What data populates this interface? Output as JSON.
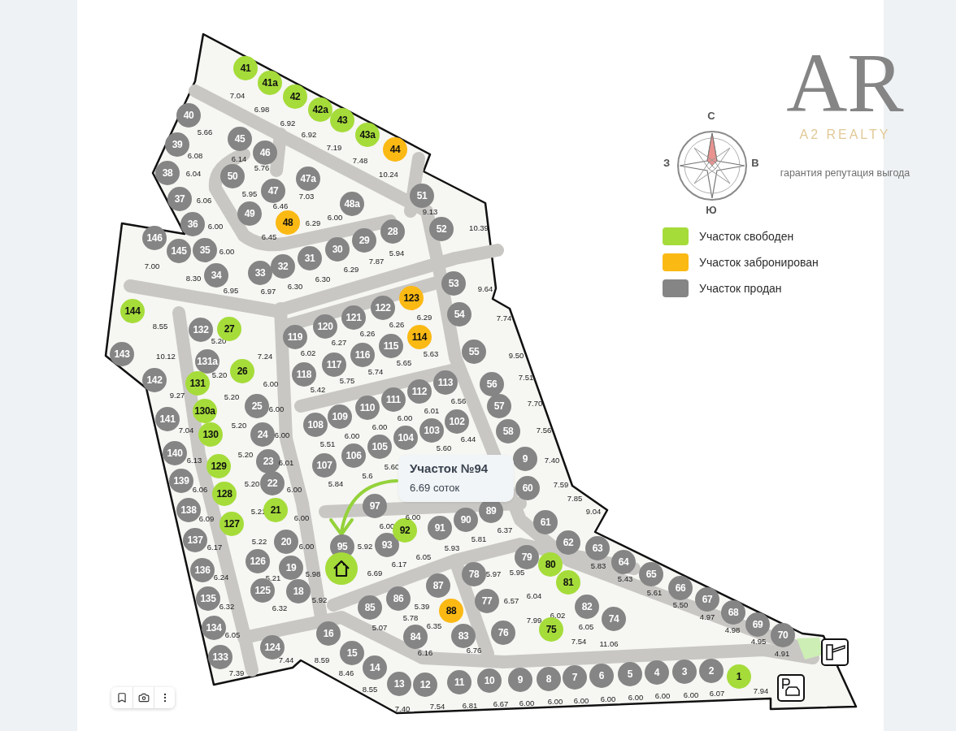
{
  "brand": {
    "mark": "AR",
    "name": "A2 REALTY",
    "tagline": "гарантия репутация выгода"
  },
  "compass": {
    "north": "С",
    "west": "З",
    "east": "В",
    "south": "Ю"
  },
  "legend": [
    {
      "label": "Участок свободен",
      "color": "#a5dc3a"
    },
    {
      "label": "Участок забронирован",
      "color": "#fbb914"
    },
    {
      "label": "Участок продан",
      "color": "#858585"
    }
  ],
  "tooltip": {
    "title": "Участок №94",
    "subtitle": "6.69 соток"
  },
  "selected_plot": {
    "area": "6.69",
    "color": "#a5dc3a"
  },
  "covered_plot": {
    "area": "6.00"
  },
  "plots": [
    {
      "number": "41",
      "area": "7.04",
      "color": "#a5dc3a"
    },
    {
      "number": "41a",
      "area": "6.98",
      "color": "#a5dc3a"
    },
    {
      "number": "42",
      "area": "6.92",
      "color": "#a5dc3a"
    },
    {
      "number": "42a",
      "area": "6.92",
      "color": "#a5dc3a"
    },
    {
      "number": "43",
      "area": "7.19",
      "color": "#a5dc3a"
    },
    {
      "number": "43a",
      "area": "7.48",
      "color": "#a5dc3a"
    },
    {
      "number": "44",
      "area": "10.24",
      "color": "#fbb914"
    },
    {
      "number": "40",
      "area": "5.66",
      "color": "#858585"
    },
    {
      "number": "39",
      "area": "6.08",
      "color": "#858585"
    },
    {
      "number": "38",
      "area": "6.04",
      "color": "#858585"
    },
    {
      "number": "37",
      "area": "6.06",
      "color": "#858585"
    },
    {
      "number": "36",
      "area": "6.00",
      "color": "#858585"
    },
    {
      "number": "35",
      "area": "6.00",
      "color": "#858585"
    },
    {
      "number": "34",
      "area": "6.95",
      "color": "#858585"
    },
    {
      "number": "45",
      "area": "6.14",
      "color": "#858585"
    },
    {
      "number": "46",
      "area": "5.76",
      "color": "#858585"
    },
    {
      "number": "50",
      "area": "5.95",
      "color": "#858585"
    },
    {
      "number": "47",
      "area": "6.46",
      "color": "#858585"
    },
    {
      "number": "47a",
      "area": "7.03",
      "color": "#858585"
    },
    {
      "number": "48a",
      "area": "6.00",
      "color": "#858585"
    },
    {
      "number": "49",
      "area": "6.45",
      "color": "#858585"
    },
    {
      "number": "48",
      "area": "6.29",
      "color": "#fbb914"
    },
    {
      "number": "51",
      "area": "9.13",
      "color": "#858585"
    },
    {
      "number": "52",
      "area": "10.39",
      "color": "#858585"
    },
    {
      "number": "146",
      "area": "7.00",
      "color": "#858585"
    },
    {
      "number": "145",
      "area": "8.30",
      "color": "#858585"
    },
    {
      "number": "33",
      "area": "6.97",
      "color": "#858585"
    },
    {
      "number": "32",
      "area": "6.30",
      "color": "#858585"
    },
    {
      "number": "31",
      "area": "6.30",
      "color": "#858585"
    },
    {
      "number": "30",
      "area": "6.29",
      "color": "#858585"
    },
    {
      "number": "29",
      "area": "7.87",
      "color": "#858585"
    },
    {
      "number": "28",
      "area": "5.94",
      "color": "#858585"
    },
    {
      "number": "53",
      "area": "9.64",
      "color": "#858585"
    },
    {
      "number": "54",
      "area": "7.74",
      "color": "#858585"
    },
    {
      "number": "55",
      "area": "9.50",
      "color": "#858585"
    },
    {
      "number": "56",
      "area": "7.51",
      "color": "#858585"
    },
    {
      "number": "57",
      "area": "7.70",
      "color": "#858585"
    },
    {
      "number": "58",
      "area": "7.56",
      "color": "#858585"
    },
    {
      "number": "9",
      "area": "7.40",
      "color": "#858585"
    },
    {
      "number": "60",
      "area": "7.59",
      "color": "#858585"
    },
    {
      "number": "61",
      "area": "7.85",
      "color": "#858585"
    },
    {
      "number": "62",
      "area": "9.04",
      "color": "#858585"
    },
    {
      "number": "63",
      "area": "5.83",
      "color": "#858585"
    },
    {
      "number": "64",
      "area": "5.43",
      "color": "#858585"
    },
    {
      "number": "65",
      "area": "5.61",
      "color": "#858585"
    },
    {
      "number": "66",
      "area": "5.50",
      "color": "#858585"
    },
    {
      "number": "67",
      "area": "4.97",
      "color": "#858585"
    },
    {
      "number": "68",
      "area": "4.98",
      "color": "#858585"
    },
    {
      "number": "69",
      "area": "4.95",
      "color": "#858585"
    },
    {
      "number": "70",
      "area": "4.91",
      "color": "#858585"
    },
    {
      "number": "144",
      "area": "8.55",
      "color": "#a5dc3a"
    },
    {
      "number": "143",
      "area": "10.12",
      "color": "#858585"
    },
    {
      "number": "142",
      "area": "9.27",
      "color": "#858585"
    },
    {
      "number": "141",
      "area": "7.04",
      "color": "#858585"
    },
    {
      "number": "140",
      "area": "6.13",
      "color": "#858585"
    },
    {
      "number": "139",
      "area": "6.06",
      "color": "#858585"
    },
    {
      "number": "138",
      "area": "6.09",
      "color": "#858585"
    },
    {
      "number": "137",
      "area": "6.17",
      "color": "#858585"
    },
    {
      "number": "136",
      "area": "6.24",
      "color": "#858585"
    },
    {
      "number": "135",
      "area": "6.32",
      "color": "#858585"
    },
    {
      "number": "134",
      "area": "6.05",
      "color": "#858585"
    },
    {
      "number": "133",
      "area": "7.39",
      "color": "#858585"
    },
    {
      "number": "132",
      "area": "5.20",
      "color": "#858585"
    },
    {
      "number": "27",
      "area": "7.24",
      "color": "#a5dc3a"
    },
    {
      "number": "131a",
      "area": "5.20",
      "color": "#858585"
    },
    {
      "number": "26",
      "area": "6.00",
      "color": "#a5dc3a"
    },
    {
      "number": "131",
      "area": "5.20",
      "color": "#a5dc3a"
    },
    {
      "number": "130a",
      "area": "5.20",
      "color": "#a5dc3a"
    },
    {
      "number": "130",
      "area": "5.20",
      "color": "#a5dc3a"
    },
    {
      "number": "129",
      "area": "5.20",
      "color": "#a5dc3a"
    },
    {
      "number": "128",
      "area": "5.21",
      "color": "#a5dc3a"
    },
    {
      "number": "127",
      "area": "5.22",
      "color": "#a5dc3a"
    },
    {
      "number": "25",
      "area": "6.00",
      "color": "#858585"
    },
    {
      "number": "24",
      "area": "6.00",
      "color": "#858585"
    },
    {
      "number": "23",
      "area": "6.01",
      "color": "#858585"
    },
    {
      "number": "22",
      "area": "6.00",
      "color": "#858585"
    },
    {
      "number": "21",
      "area": "6.00",
      "color": "#a5dc3a"
    },
    {
      "number": "20",
      "area": "6.00",
      "color": "#858585"
    },
    {
      "number": "126",
      "area": "5.21",
      "color": "#858585"
    },
    {
      "number": "19",
      "area": "5.98",
      "color": "#858585"
    },
    {
      "number": "125",
      "area": "6.32",
      "color": "#858585"
    },
    {
      "number": "18",
      "area": "5.92",
      "color": "#858585"
    },
    {
      "number": "124",
      "area": "7.44",
      "color": "#858585"
    },
    {
      "number": "16",
      "area": "8.59",
      "color": "#858585"
    },
    {
      "number": "15",
      "area": "8.46",
      "color": "#858585"
    },
    {
      "number": "14",
      "area": "8.55",
      "color": "#858585"
    },
    {
      "number": "13",
      "area": "7.40",
      "color": "#858585"
    },
    {
      "number": "12",
      "area": "7.54",
      "color": "#858585"
    },
    {
      "number": "11",
      "area": "6.81",
      "color": "#858585"
    },
    {
      "number": "10",
      "area": "6.67",
      "color": "#858585"
    },
    {
      "number": "9",
      "area": "6.00",
      "color": "#858585"
    },
    {
      "number": "8",
      "area": "6.00",
      "color": "#858585"
    },
    {
      "number": "7",
      "area": "6.00",
      "color": "#858585"
    },
    {
      "number": "6",
      "area": "6.00",
      "color": "#858585"
    },
    {
      "number": "5",
      "area": "6.00",
      "color": "#858585"
    },
    {
      "number": "4",
      "area": "6.00",
      "color": "#858585"
    },
    {
      "number": "3",
      "area": "6.00",
      "color": "#858585"
    },
    {
      "number": "2",
      "area": "6.07",
      "color": "#858585"
    },
    {
      "number": "1",
      "area": "7.94",
      "color": "#a5dc3a"
    },
    {
      "number": "119",
      "area": "6.02",
      "color": "#858585"
    },
    {
      "number": "120",
      "area": "6.27",
      "color": "#858585"
    },
    {
      "number": "121",
      "area": "6.26",
      "color": "#858585"
    },
    {
      "number": "122",
      "area": "6.26",
      "color": "#858585"
    },
    {
      "number": "123",
      "area": "6.29",
      "color": "#fbb914"
    },
    {
      "number": "118",
      "area": "5.42",
      "color": "#858585"
    },
    {
      "number": "117",
      "area": "5.75",
      "color": "#858585"
    },
    {
      "number": "116",
      "area": "5.74",
      "color": "#858585"
    },
    {
      "number": "115",
      "area": "5.65",
      "color": "#858585"
    },
    {
      "number": "114",
      "area": "5.63",
      "color": "#fbb914"
    },
    {
      "number": "108",
      "area": "5.51",
      "color": "#858585"
    },
    {
      "number": "109",
      "area": "6.00",
      "color": "#858585"
    },
    {
      "number": "110",
      "area": "6.00",
      "color": "#858585"
    },
    {
      "number": "111",
      "area": "6.00",
      "color": "#858585"
    },
    {
      "number": "112",
      "area": "6.01",
      "color": "#858585"
    },
    {
      "number": "113",
      "area": "6.56",
      "color": "#858585"
    },
    {
      "number": "107",
      "area": "5.84",
      "color": "#858585"
    },
    {
      "number": "106",
      "area": "5.6",
      "color": "#858585"
    },
    {
      "number": "105",
      "area": "5.60",
      "color": "#858585"
    },
    {
      "number": "104",
      "color": "#858585"
    },
    {
      "number": "103",
      "area": "5.60",
      "color": "#858585"
    },
    {
      "number": "102",
      "area": "6.44",
      "color": "#858585"
    },
    {
      "number": "97",
      "area": "6.00",
      "color": "#858585"
    },
    {
      "number": "95",
      "area": "5.92",
      "color": "#858585"
    },
    {
      "number": "93",
      "area": "6.17",
      "color": "#858585"
    },
    {
      "number": "92",
      "area": "6.05",
      "color": "#a5dc3a"
    },
    {
      "number": "91",
      "area": "5.93",
      "color": "#858585"
    },
    {
      "number": "90",
      "area": "5.81",
      "color": "#858585"
    },
    {
      "number": "89",
      "area": "6.37",
      "color": "#858585"
    },
    {
      "number": "87",
      "area": "5.39",
      "color": "#858585"
    },
    {
      "number": "78",
      "area": "5.97",
      "color": "#858585"
    },
    {
      "number": "79",
      "area": "5.95",
      "color": "#858585"
    },
    {
      "number": "80",
      "area": "6.04",
      "color": "#a5dc3a"
    },
    {
      "number": "81",
      "area": "6.02",
      "color": "#a5dc3a"
    },
    {
      "number": "85",
      "area": "5.07",
      "color": "#858585"
    },
    {
      "number": "86",
      "area": "5.78",
      "color": "#858585"
    },
    {
      "number": "88",
      "area": "6.35",
      "color": "#fbb914"
    },
    {
      "number": "77",
      "area": "6.57",
      "color": "#858585"
    },
    {
      "number": "82",
      "area": "6.05",
      "color": "#858585"
    },
    {
      "number": "74",
      "area": "11.06",
      "color": "#858585"
    },
    {
      "number": "84",
      "area": "6.16",
      "color": "#858585"
    },
    {
      "number": "83",
      "area": "6.76",
      "color": "#858585"
    },
    {
      "number": "76",
      "area": "7.99",
      "color": "#858585"
    },
    {
      "number": "75",
      "area": "7.54",
      "color": "#a5dc3a"
    }
  ]
}
